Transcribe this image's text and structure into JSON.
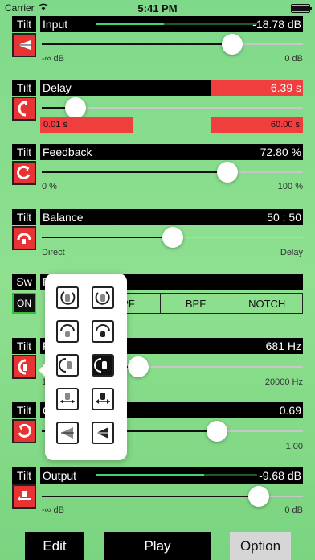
{
  "status": {
    "carrier": "Carrier",
    "time": "5:41 PM"
  },
  "rows": [
    {
      "id": "input",
      "side_label": "Tilt",
      "name": "Input",
      "value": "-18.78 dB",
      "meter_level": 0.42,
      "slider_pos": 0.73,
      "min_label": "-∞ dB",
      "max_label": "0 dB"
    },
    {
      "id": "delay",
      "side_label": "Tilt",
      "name": "Delay",
      "value": "6.39 s",
      "slider_pos": 0.13,
      "min_label": "0.01 s",
      "max_label": "60.00 s"
    },
    {
      "id": "feedback",
      "side_label": "Tilt",
      "name": "Feedback",
      "value": "72.80 %",
      "slider_pos": 0.71,
      "min_label": "0 %",
      "max_label": "100 %"
    },
    {
      "id": "balance",
      "side_label": "Tilt",
      "name": "Balance",
      "value": "50 : 50",
      "slider_pos": 0.5,
      "min_label": "Direct",
      "max_label": "Delay"
    },
    {
      "id": "filter",
      "side_label": "Sw",
      "name": "F",
      "on_label": "ON",
      "tabs": [
        "HPF",
        "BPF",
        "NOTCH"
      ]
    },
    {
      "id": "freq",
      "side_label": "Tilt",
      "name": "F",
      "value": "681 Hz",
      "slider_pos": 0.37,
      "min_label": "1",
      "max_label": "20000 Hz"
    },
    {
      "id": "q",
      "side_label": "Tilt",
      "name": "Q",
      "value": "0.69",
      "slider_pos": 0.67,
      "min_label": "",
      "max_label": "1.00"
    },
    {
      "id": "output",
      "side_label": "Tilt",
      "name": "Output",
      "value": "-9.68 dB",
      "meter_level": 0.67,
      "slider_pos": 0.83,
      "min_label": "-∞ dB",
      "max_label": "0 dB"
    }
  ],
  "popover": {
    "selected_index": 5
  },
  "bottom": {
    "edit": "Edit",
    "play": "Play",
    "option": "Option"
  },
  "colors": {
    "accent_red": "#e73333",
    "meter_green": "#3ed66b",
    "background": "#8ee08f"
  }
}
